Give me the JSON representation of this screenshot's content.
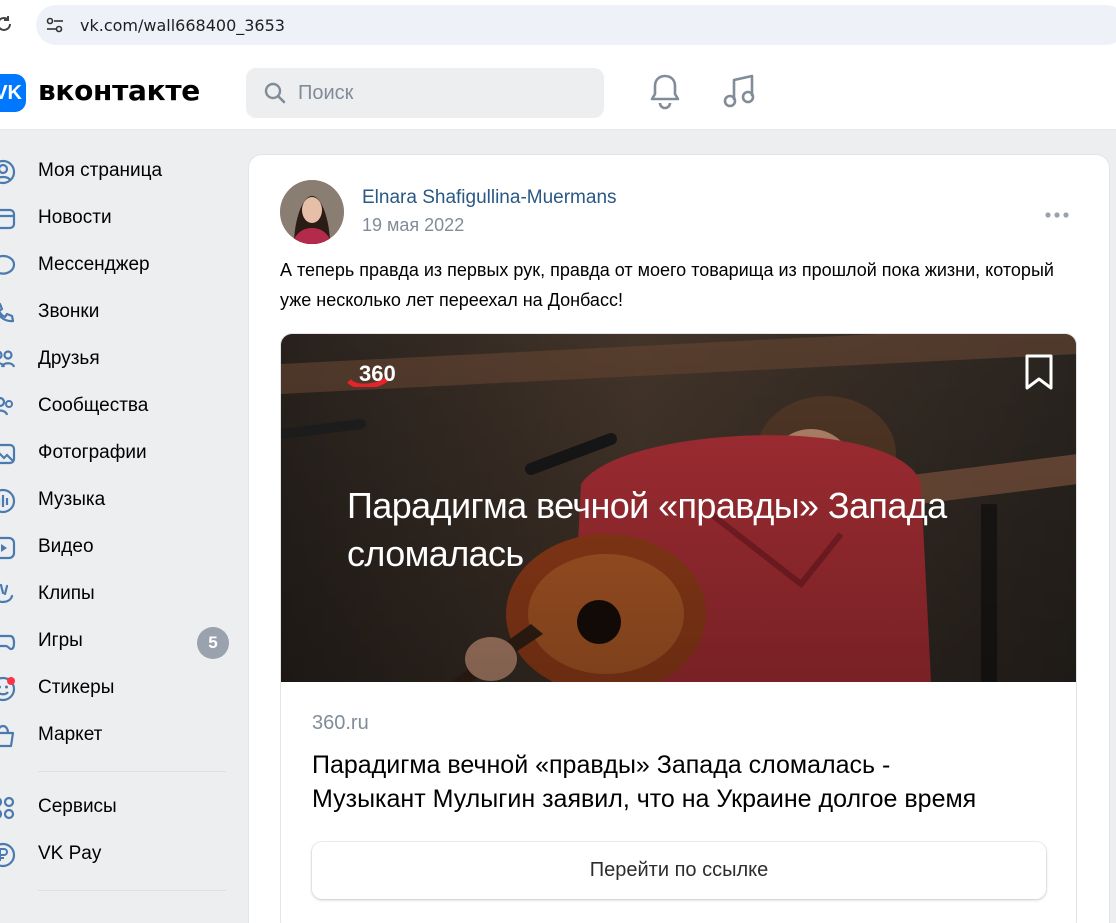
{
  "browser": {
    "url": "vk.com/wall668400_3653",
    "reload_icon": "reload-icon",
    "site_info_icon": "site-info-icon"
  },
  "header": {
    "logo_mark": "VK",
    "logo_text": "вконтакте",
    "search_placeholder": "Поиск",
    "icons": [
      "search-icon",
      "bell-icon",
      "music-icon"
    ],
    "accent_color": "#0077ff"
  },
  "sidebar": {
    "items": [
      {
        "label": "Моя страница",
        "icon": "user-circle-icon"
      },
      {
        "label": "Новости",
        "icon": "newspaper-icon"
      },
      {
        "label": "Мессенджер",
        "icon": "chat-bubble-icon"
      },
      {
        "label": "Звонки",
        "icon": "phone-icon"
      },
      {
        "label": "Друзья",
        "icon": "friends-icon"
      },
      {
        "label": "Сообщества",
        "icon": "communities-icon"
      },
      {
        "label": "Фотографии",
        "icon": "photo-icon"
      },
      {
        "label": "Музыка",
        "icon": "music-bars-icon"
      },
      {
        "label": "Видео",
        "icon": "video-play-icon"
      },
      {
        "label": "Клипы",
        "icon": "clips-icon"
      },
      {
        "label": "Игры",
        "icon": "gamepad-icon",
        "badge": "5"
      },
      {
        "label": "Стикеры",
        "icon": "sticker-smile-icon",
        "dot": true
      },
      {
        "label": "Маркет",
        "icon": "market-bag-icon"
      }
    ],
    "items_bottom": [
      {
        "label": "Сервисы",
        "icon": "services-grid-icon"
      },
      {
        "label": "VK Pay",
        "icon": "vk-pay-icon"
      }
    ],
    "badge_color": "#99a2ad",
    "notification_dot_color": "#ff3347"
  },
  "post": {
    "author": "Elnara Shafigullina-Muermans",
    "date": "19 мая 2022",
    "text": "А теперь правда из первых рук, правда от моего товарища из прошлой пока жизни, который уже несколько лет переехал на Донбасс!",
    "author_color": "#2a5885",
    "link": {
      "brand": "360",
      "image_title": "Парадигма вечной «правды» Запада сломалась",
      "domain": "360.ru",
      "title_line1": "Парадигма вечной «правды» Запада сломалась -",
      "title_line2": "Музыкант Мулыгин заявил, что на Украине долгое время",
      "button": "Перейти по ссылке"
    }
  }
}
